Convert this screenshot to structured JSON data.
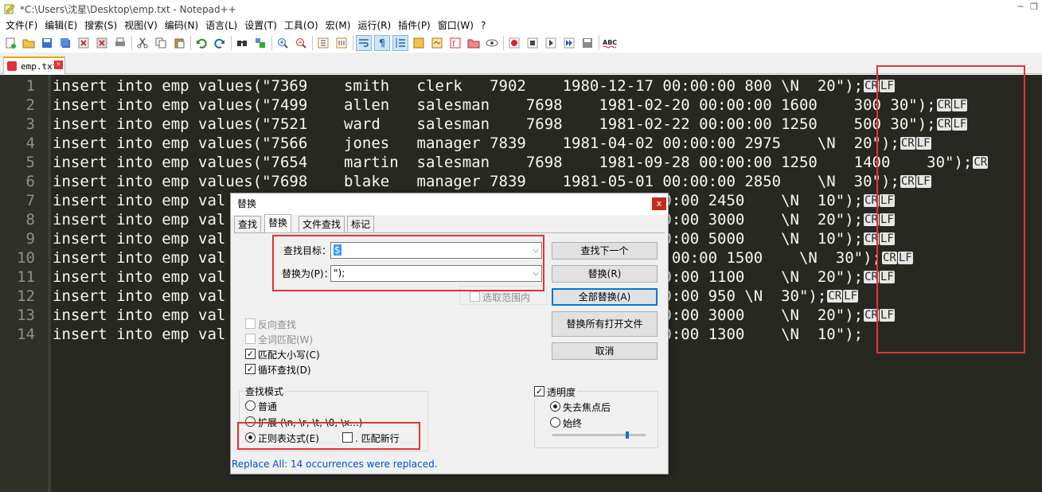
{
  "window": {
    "title": "*C:\\Users\\沈星\\Desktop\\emp.txt - Notepad++"
  },
  "menu": [
    "文件(F)",
    "编辑(E)",
    "搜索(S)",
    "视图(V)",
    "编码(N)",
    "语言(L)",
    "设置(T)",
    "工具(O)",
    "宏(M)",
    "运行(R)",
    "插件(P)",
    "窗口(W)",
    "?"
  ],
  "tab": {
    "name": "emp.txt"
  },
  "colors": {
    "editor_bg": "#272822",
    "text": "#f8f8f2",
    "annotation": "#e53333"
  },
  "editor": {
    "lines": [
      {
        "n": "1",
        "text": "insert into emp values(\"7369    smith   clerk   7902    1980-12-17 00:00:00 800 \\N  20\");",
        "eol": [
          "CR",
          "LF"
        ]
      },
      {
        "n": "2",
        "text": "insert into emp values(\"7499    allen   salesman    7698    1981-02-20 00:00:00 1600    300 30\");",
        "eol": [
          "CR",
          "LF"
        ]
      },
      {
        "n": "3",
        "text": "insert into emp values(\"7521    ward    salesman    7698    1981-02-22 00:00:00 1250    500 30\");",
        "eol": [
          "CR",
          "LF"
        ]
      },
      {
        "n": "4",
        "text": "insert into emp values(\"7566    jones   manager 7839    1981-04-02 00:00:00 2975    \\N  20\");",
        "eol": [
          "CR",
          "LF"
        ]
      },
      {
        "n": "5",
        "text": "insert into emp values(\"7654    martin  salesman    7698    1981-09-28 00:00:00 1250    1400    30\");",
        "eol": [
          "CR"
        ]
      },
      {
        "n": "6",
        "text": "insert into emp values(\"7698    blake   manager 7839    1981-05-01 00:00:00 2850    \\N  30\");",
        "eol": [
          "CR",
          "LF"
        ]
      },
      {
        "n": "7",
        "text": "insert into emp val                                         09 00:00:00 2450    \\N  10\");",
        "eol": [
          "CR",
          "LF"
        ]
      },
      {
        "n": "8",
        "text": "insert into emp val                                         19 00:00:00 3000    \\N  20\");",
        "eol": [
          "CR",
          "LF"
        ]
      },
      {
        "n": "9",
        "text": "insert into emp val                                         17 00:00:00 5000    \\N  10\");",
        "eol": [
          "CR",
          "LF"
        ]
      },
      {
        "n": "10",
        "text": "insert into emp val                                       -09-08 00:00:00 1500    \\N  30\");",
        "eol": [
          "CR",
          "LF"
        ]
      },
      {
        "n": "11",
        "text": "insert into emp val                                         23 00:00:00 1100    \\N  20\");",
        "eol": [
          "CR",
          "LF"
        ]
      },
      {
        "n": "12",
        "text": "insert into emp val                                         03 00:00:00 950 \\N  30\");",
        "eol": [
          "CR",
          "LF"
        ]
      },
      {
        "n": "13",
        "text": "insert into emp val                                         03 00:00:00 3000    \\N  20\");",
        "eol": [
          "CR",
          "LF"
        ]
      },
      {
        "n": "14",
        "text": "insert into emp val                                         23 00:00:00 1300    \\N  10\");",
        "eol": []
      }
    ]
  },
  "dialog": {
    "title": "替换",
    "close": "x",
    "tabs": [
      "查找",
      "替换",
      "文件查找",
      "标记"
    ],
    "find_label": "查找目标：",
    "find_value": "$",
    "replace_label": "替换为(P)：",
    "replace_value": "\");",
    "in_selection": "选取范围内",
    "buttons": {
      "find_next": "查找下一个",
      "replace": "替换(R)",
      "replace_all": "全部替换(A)",
      "replace_all_open": "替换所有打开文件",
      "cancel": "取消"
    },
    "options": {
      "backward": "反向查找",
      "whole_word": "全词匹配(W)",
      "match_case": "匹配大小写(C)",
      "wrap": "循环查找(D)"
    },
    "search_mode": {
      "title": "查找模式",
      "normal": "普通",
      "extended": "扩展 (\\n, \\r, \\t, \\0, \\x...)",
      "regex": "正则表达式(E)",
      "dot_newline": ". 匹配新行"
    },
    "transparency": {
      "title": "透明度",
      "on_lose_focus": "失去焦点后",
      "always": "始终",
      "level": 0.8
    },
    "status": "Replace All: 14 occurrences were replaced."
  }
}
